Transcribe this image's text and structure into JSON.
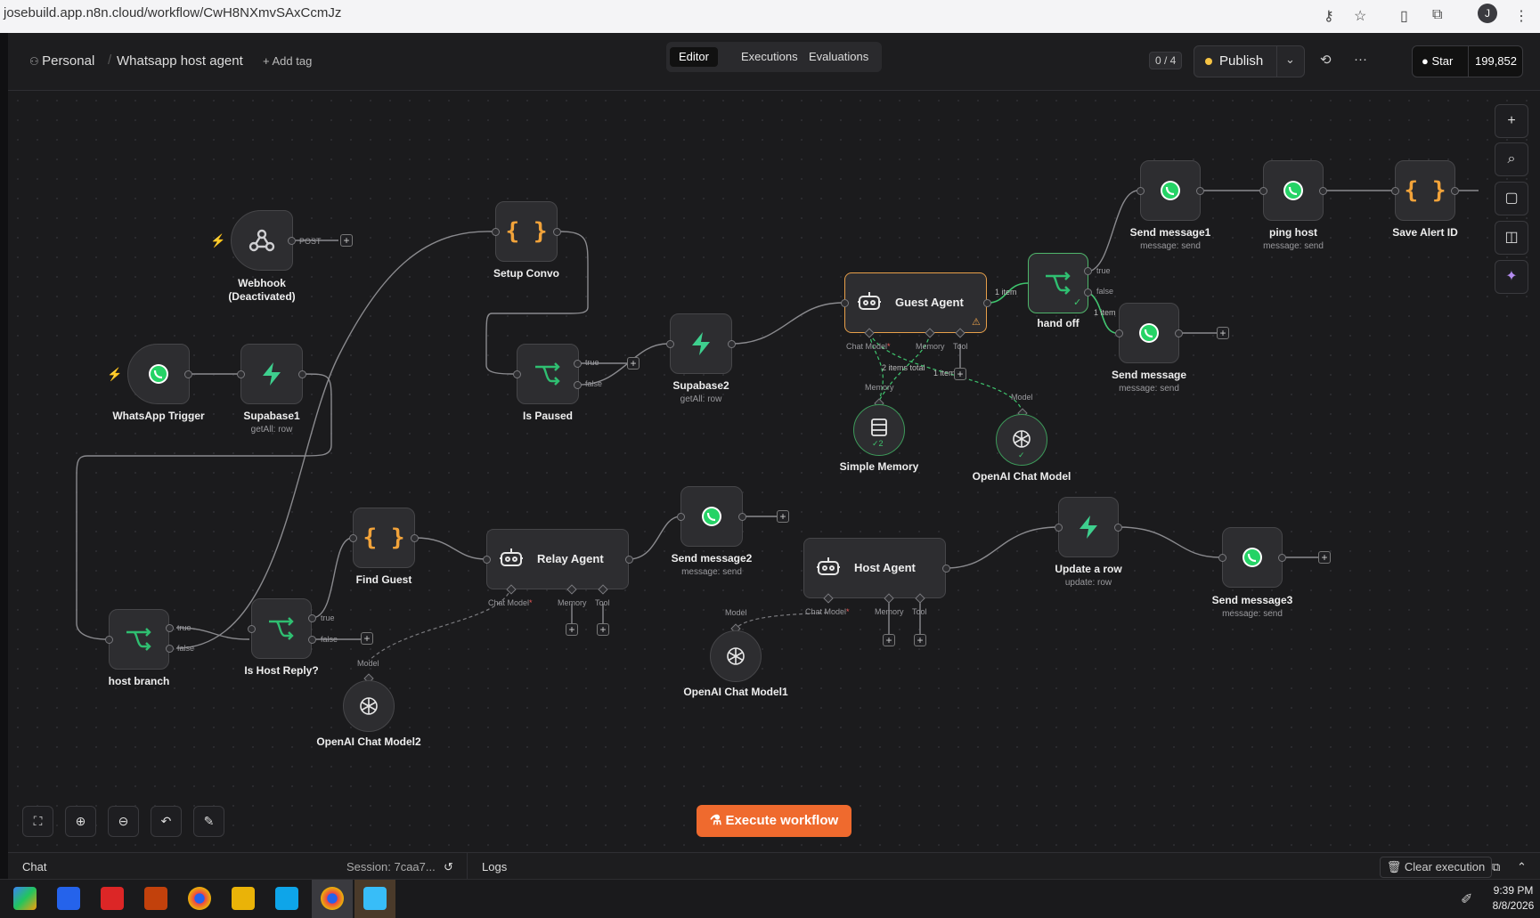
{
  "browser": {
    "url": "josebuild.app.n8n.cloud/workflow/CwH8NXmvSAxCcmJz",
    "avatar": "J"
  },
  "header": {
    "project": "Personal",
    "workflow_name": "Whatsapp host agent",
    "add_tag": "+ Add tag",
    "tabs": [
      "Editor",
      "Executions",
      "Evaluations"
    ],
    "counter": "0 / 4",
    "publish": "Publish",
    "github_star": "Star",
    "github_count": "199,852"
  },
  "nodes": {
    "webhook": {
      "title": "Webhook",
      "sub": "(Deactivated)",
      "port": "POST"
    },
    "whatsapp_trigger": {
      "title": "WhatsApp Trigger"
    },
    "supabase1": {
      "title": "Supabase1",
      "sub": "getAll: row"
    },
    "setup_convo": {
      "title": "Setup Convo"
    },
    "is_paused": {
      "title": "Is Paused",
      "true": "true",
      "false": "false"
    },
    "supabase2": {
      "title": "Supabase2",
      "sub": "getAll: row"
    },
    "guest_agent": {
      "title": "Guest Agent",
      "chat_model": "Chat Model",
      "memory": "Memory",
      "tool": "Tool",
      "items_total": "2 items total",
      "one_item": "1 item"
    },
    "hand_off": {
      "title": "hand off",
      "in_item": "1 item",
      "true": "true",
      "false": "false",
      "out_item": "1 item"
    },
    "send_message1": {
      "title": "Send message1",
      "sub": "message: send"
    },
    "ping_host": {
      "title": "ping host",
      "sub": "message: send"
    },
    "save_alert": {
      "title": "Save Alert ID"
    },
    "send_message": {
      "title": "Send message",
      "sub": "message: send"
    },
    "simple_memory": {
      "title": "Simple Memory",
      "label": "Memory",
      "badge": "2"
    },
    "openai_chat": {
      "title": "OpenAI Chat Model",
      "label": "Model"
    },
    "host_branch": {
      "title": "host branch",
      "true": "true",
      "false": "false"
    },
    "is_host_reply": {
      "title": "Is Host Reply?",
      "true": "true",
      "false": "false"
    },
    "find_guest": {
      "title": "Find Guest"
    },
    "relay_agent": {
      "title": "Relay Agent",
      "chat_model": "Chat Model",
      "memory": "Memory",
      "tool": "Tool"
    },
    "send_message2": {
      "title": "Send message2",
      "sub": "message: send"
    },
    "openai_chat2": {
      "title": "OpenAI Chat Model2",
      "label": "Model"
    },
    "host_agent": {
      "title": "Host Agent",
      "chat_model": "Chat Model",
      "memory": "Memory",
      "tool": "Tool"
    },
    "openai_chat1": {
      "title": "OpenAI Chat Model1",
      "label": "Model"
    },
    "update_row": {
      "title": "Update a row",
      "sub": "update: row"
    },
    "send_message3": {
      "title": "Send message3",
      "sub": "message: send"
    }
  },
  "canvas": {
    "execute": "Execute workflow"
  },
  "bottom": {
    "chat": "Chat",
    "session": "Session: 7caa7...",
    "logs": "Logs",
    "clear": "Clear execution"
  },
  "taskbar": {
    "time": "9:39 PM",
    "date": "8/8/2026"
  },
  "colors": {
    "accent": "#ef6a2e",
    "whatsapp": "#25d366",
    "supabase": "#3ecf8e",
    "switch": "#2fbf71",
    "code": "#f2a33a"
  }
}
